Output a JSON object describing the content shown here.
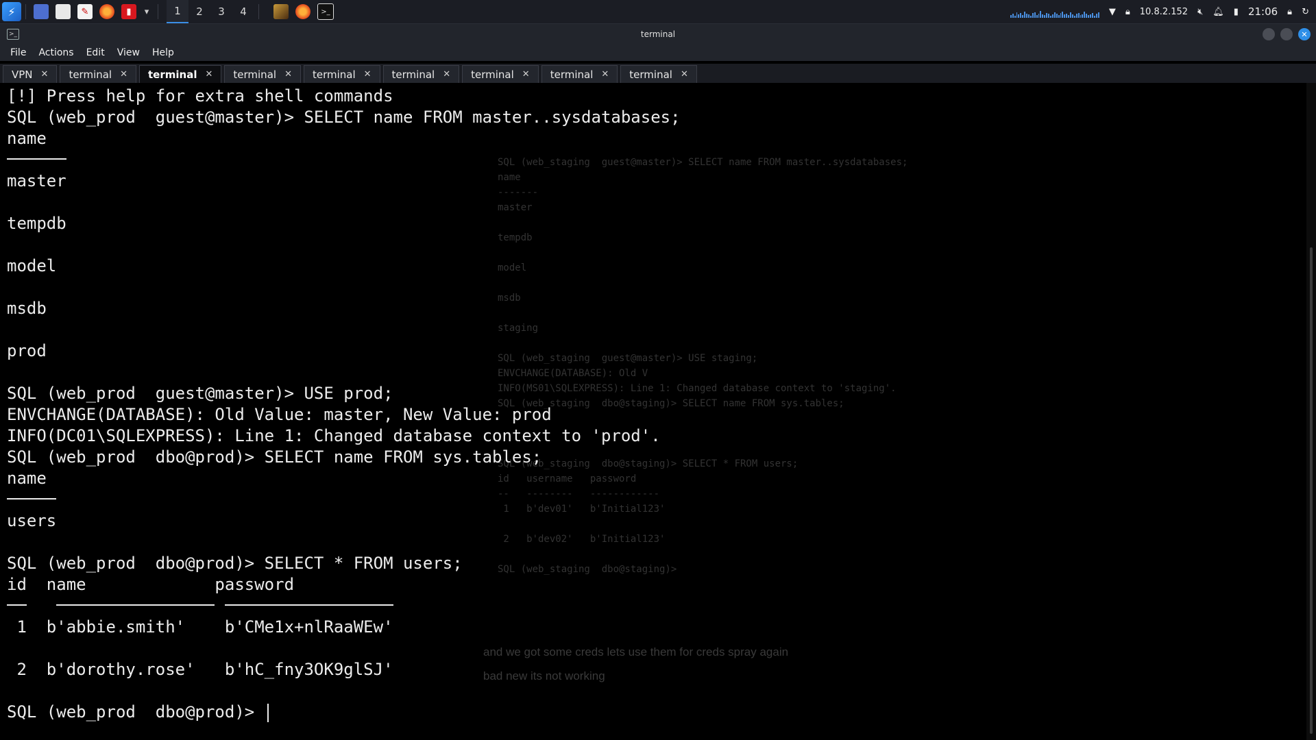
{
  "panel": {
    "workspaces": [
      "1",
      "2",
      "3",
      "4"
    ],
    "active_workspace": "1",
    "ip": "10.8.2.152",
    "clock": "21:06",
    "icons": [
      "kali-menu-icon",
      "desktop-icon",
      "file-manager-icon",
      "text-editor-icon",
      "firefox-icon",
      "terminal-red-icon",
      "chevron-down-icon",
      "app-thumb-icon",
      "firefox-window-icon",
      "terminal-window-icon",
      "network-graph-icon",
      "wifi-icon",
      "vpn-lock-icon",
      "mute-icon",
      "bell-icon",
      "battery-icon",
      "lock-icon",
      "refresh-icon"
    ]
  },
  "window": {
    "title": "terminal"
  },
  "menu": [
    "File",
    "Actions",
    "Edit",
    "View",
    "Help"
  ],
  "tabs": [
    {
      "label": "VPN",
      "active": false
    },
    {
      "label": "terminal",
      "active": false
    },
    {
      "label": "terminal",
      "active": true
    },
    {
      "label": "terminal",
      "active": false
    },
    {
      "label": "terminal",
      "active": false
    },
    {
      "label": "terminal",
      "active": false
    },
    {
      "label": "terminal",
      "active": false
    },
    {
      "label": "terminal",
      "active": false
    },
    {
      "label": "terminal",
      "active": false
    }
  ],
  "terminal": {
    "lines": [
      {
        "text": "[!] Press help for extra shell commands"
      },
      {
        "text": "SQL (web_prod  guest@master)> SELECT name FROM master..sysdatabases;"
      },
      {
        "text": "name"
      },
      {
        "underline": [
          [
            0,
            6
          ]
        ]
      },
      {
        "text": "master"
      },
      {
        "text": ""
      },
      {
        "text": "tempdb"
      },
      {
        "text": ""
      },
      {
        "text": "model"
      },
      {
        "text": ""
      },
      {
        "text": "msdb"
      },
      {
        "text": ""
      },
      {
        "text": "prod"
      },
      {
        "text": ""
      },
      {
        "text": "SQL (web_prod  guest@master)> USE prod;"
      },
      {
        "text": "ENVCHANGE(DATABASE): Old Value: master, New Value: prod"
      },
      {
        "text": "INFO(DC01\\SQLEXPRESS): Line 1: Changed database context to 'prod'."
      },
      {
        "text": "SQL (web_prod  dbo@prod)> SELECT name FROM sys.tables;"
      },
      {
        "text": "name"
      },
      {
        "underline": [
          [
            0,
            5
          ]
        ]
      },
      {
        "text": "users"
      },
      {
        "text": ""
      },
      {
        "text": "SQL (web_prod  dbo@prod)> SELECT * FROM users;"
      },
      {
        "text": "id  name             password"
      },
      {
        "underline": [
          [
            0,
            2
          ],
          [
            5,
            16
          ],
          [
            22,
            17
          ]
        ]
      },
      {
        "text": " 1  b'abbie.smith'    b'CMe1x+nlRaaWEw'"
      },
      {
        "text": ""
      },
      {
        "text": " 2  b'dorothy.rose'   b'hC_fny3OK9glSJ'"
      },
      {
        "text": ""
      },
      {
        "text": "SQL (web_prod  dbo@prod)> ",
        "cursor": true
      }
    ]
  },
  "background_notes": {
    "lines": [
      "SQL (web_staging  guest@master)> SELECT name FROM master..sysdatabases;",
      "name",
      "-------",
      "master",
      "",
      "tempdb",
      "",
      "model",
      "",
      "msdb",
      "",
      "staging",
      "",
      "SQL (web_staging  guest@master)> USE staging;",
      "ENVCHANGE(DATABASE): Old V",
      "INFO(MS01\\SQLEXPRESS): Line 1: Changed database context to 'staging'.",
      "SQL (web_staging  dbo@staging)> SELECT name FROM sys.tables;",
      "",
      "",
      "",
      "SQL (web_staging  dbo@staging)> SELECT * FROM users;",
      "id   username   password",
      "--   --------   ------------",
      " 1   b'dev01'   b'Initial123'",
      "",
      " 2   b'dev02'   b'Initial123'",
      "",
      "SQL (web_staging  dbo@staging)>"
    ],
    "note1": "and we got some creds lets use them for creds spray again",
    "note2": "bad new its not working"
  }
}
